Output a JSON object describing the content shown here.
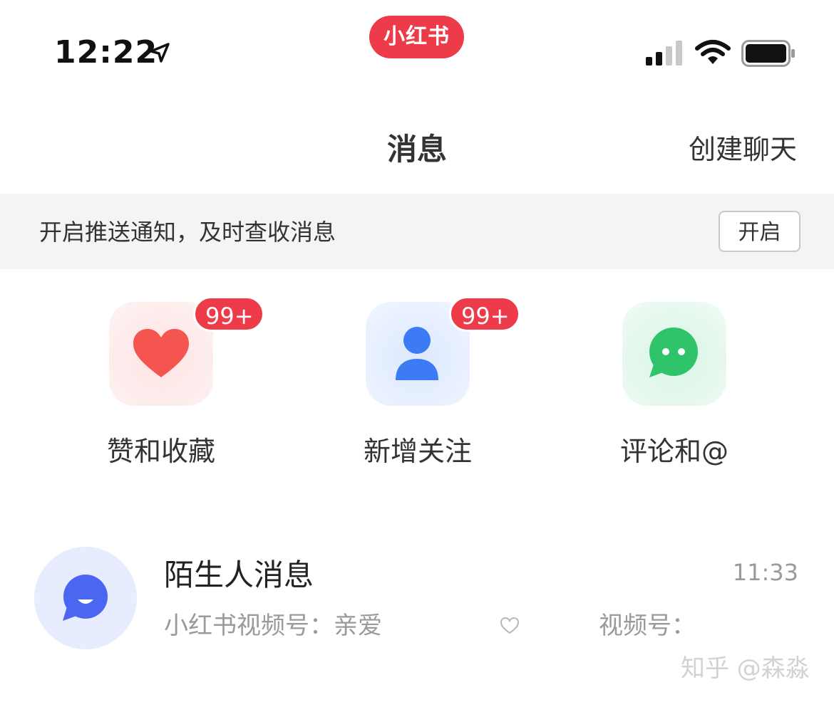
{
  "status_bar": {
    "time": "12:22",
    "location_icon": "location-arrow-icon",
    "app_pill": "小红书",
    "signal_icon": "cellular-signal-icon",
    "wifi_icon": "wifi-icon",
    "battery_icon": "battery-icon"
  },
  "nav": {
    "title": "消息",
    "right_action": "创建聊天"
  },
  "banner": {
    "text": "开启推送通知，及时查收消息",
    "button": "开启"
  },
  "shortcuts": [
    {
      "label": "赞和收藏",
      "badge": "99+",
      "icon": "heart-icon",
      "color": "#f4564f"
    },
    {
      "label": "新增关注",
      "badge": "99+",
      "icon": "person-icon",
      "color": "#3d7bf4"
    },
    {
      "label": "评论和@",
      "badge": "",
      "icon": "chat-bubble-icon",
      "color": "#2fc46a"
    }
  ],
  "messages": [
    {
      "title": "陌生人消息",
      "time": "11:33",
      "preview_start": "小红书视频号：亲爱",
      "preview_end": "视频号：",
      "icon": "stranger-chat-icon",
      "icon_color": "#4b66f0"
    }
  ],
  "watermark": "知乎 @森淼",
  "colors": {
    "accent": "#ee3b4a",
    "banner_bg": "#f4f4f4",
    "muted_text": "#9a9a9a"
  }
}
